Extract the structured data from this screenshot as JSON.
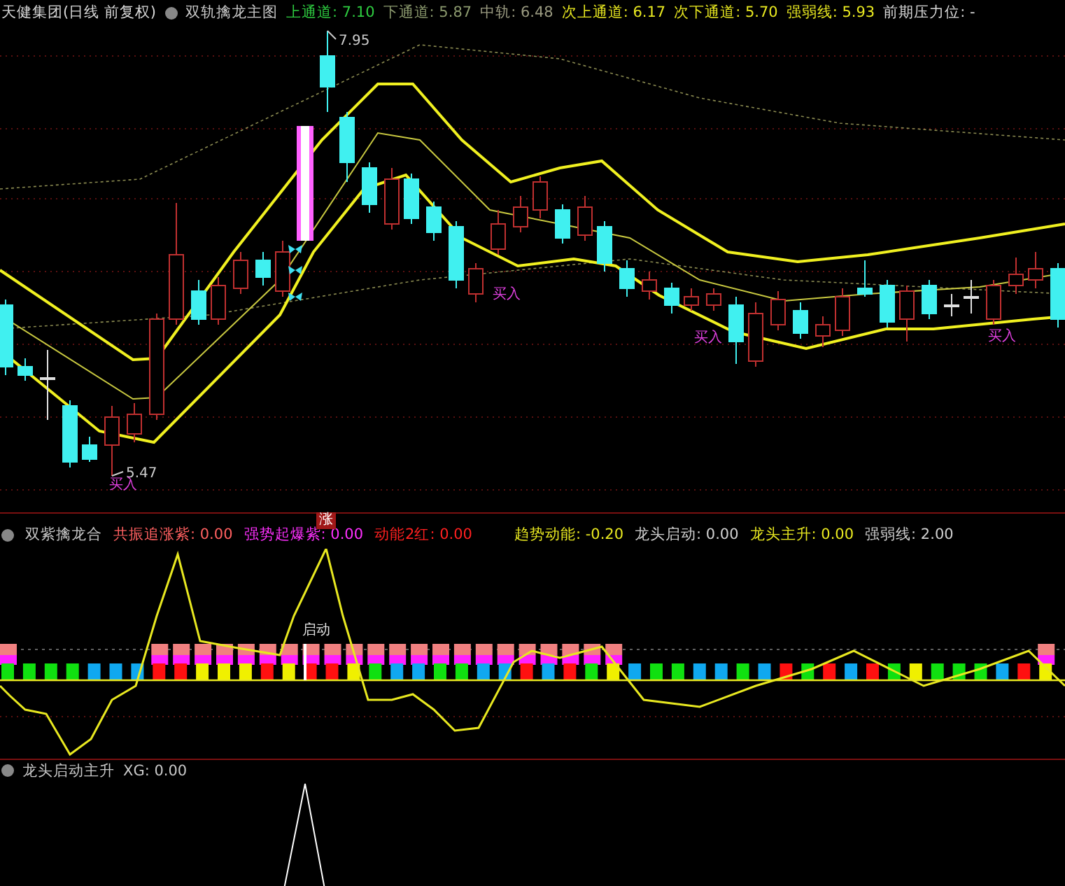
{
  "main_panel": {
    "stock_title": "天健集团(日线 前复权)",
    "indicator_name": "双轨擒龙主图",
    "values": [
      {
        "label": "上通道: 7.10",
        "color": "#2ecc40"
      },
      {
        "label": "下通道: 5.87",
        "color": "#8c9a6e"
      },
      {
        "label": "中轨: 6.48",
        "color": "#9a9a80"
      },
      {
        "label": "次上通道: 6.17",
        "color": "#e8e820"
      },
      {
        "label": "次下通道: 5.70",
        "color": "#e8e820"
      },
      {
        "label": "强弱线: 5.93",
        "color": "#e8e820"
      }
    ],
    "right_label": "前期压力位: -",
    "high_label": "7.95",
    "low_label": "5.47",
    "signals": [
      "买入",
      "买入",
      "买入",
      "买入"
    ]
  },
  "badge": "涨",
  "sub_panel_1": {
    "indicator_name": "双紫擒龙合",
    "values": [
      {
        "label": "共振追涨紫: 0.00",
        "color": "#ff6060"
      },
      {
        "label": "强势起爆紫: 0.00",
        "color": "#ff30ff"
      },
      {
        "label": "动能2红: 0.00",
        "color": "#ff2020"
      },
      {
        "label": "趋势动能: -0.20",
        "color": "#e8e820"
      },
      {
        "label": "龙头启动: 0.00",
        "color": "#d0d0d0"
      },
      {
        "label": "龙头主升: 0.00",
        "color": "#e8e820"
      },
      {
        "label": "强弱线: 2.00",
        "color": "#d0d0d0"
      }
    ],
    "marker": "启动"
  },
  "sub_panel_2": {
    "indicator_name": "龙头启动主升",
    "values": [
      {
        "label": "XG: 0.00",
        "color": "#c8c8c8"
      }
    ]
  }
}
